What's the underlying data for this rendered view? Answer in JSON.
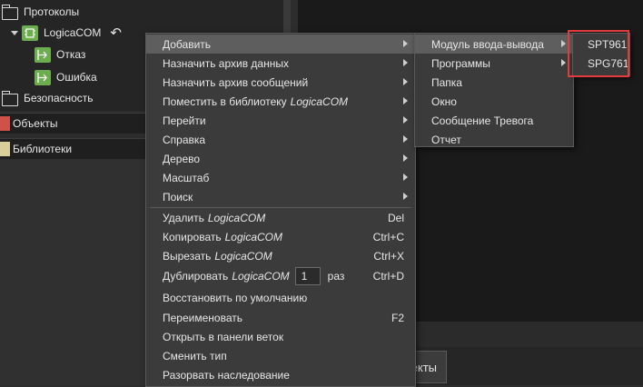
{
  "tree": {
    "protocols": "Протоколы",
    "logica": "LogicaCOM",
    "otkaz": "Отказ",
    "oshibka": "Ошибка",
    "security": "Безопасность"
  },
  "sections": {
    "objects": "Объекты",
    "libraries": "Библиотеки"
  },
  "bottom_tab": "ьекты",
  "context_menu": {
    "items": [
      {
        "label": "Добавить"
      },
      {
        "label": "Назначить архив данных"
      },
      {
        "label": "Назначить архив сообщений"
      },
      {
        "label": "Поместить в библиотеку",
        "italic": "LogicaCOM"
      },
      {
        "label": "Перейти"
      },
      {
        "label": "Справка"
      },
      {
        "label": "Дерево"
      },
      {
        "label": "Масштаб"
      },
      {
        "label": "Поиск"
      },
      {
        "label": "Удалить",
        "italic": "LogicaCOM",
        "shortcut": "Del"
      },
      {
        "label": "Копировать",
        "italic": "LogicaCOM",
        "shortcut": "Ctrl+C"
      },
      {
        "label": "Вырезать",
        "italic": "LogicaCOM",
        "shortcut": "Ctrl+X"
      },
      {
        "label": "Дублировать",
        "italic": "LogicaCOM",
        "count": "1",
        "suffix": "раз",
        "shortcut": "Ctrl+D"
      },
      {
        "label": "Восстановить по умолчанию"
      },
      {
        "label": "Переименовать",
        "shortcut": "F2"
      },
      {
        "label": "Открыть в панели веток"
      },
      {
        "label": "Сменить тип"
      },
      {
        "label": "Разорвать наследование"
      }
    ]
  },
  "submenu": [
    "Модуль ввода-вывода",
    "Программы",
    "Папка",
    "Окно",
    "Сообщение Тревога",
    "Отчет"
  ],
  "submenu2": [
    "SPT961",
    "SPG761"
  ],
  "colors": {
    "highlight_border": "#e23b3b",
    "menu_bg": "#3b3b3b",
    "tree_icon": "#6cad4f"
  }
}
